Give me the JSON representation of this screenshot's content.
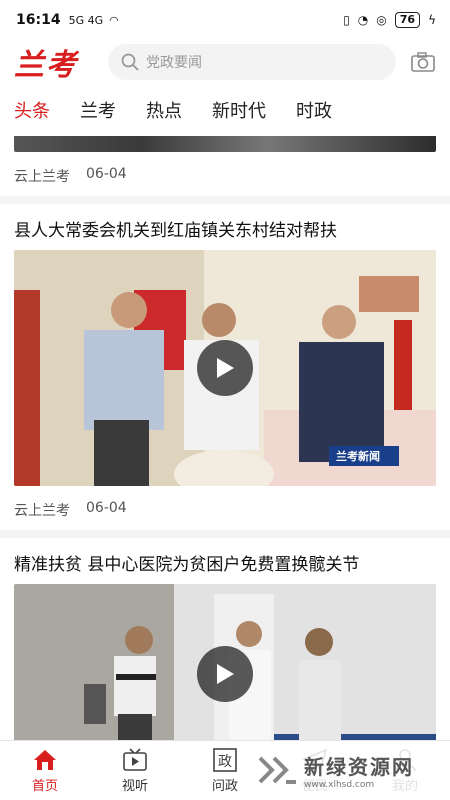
{
  "status_bar": {
    "time": "16:14",
    "signal_left": "5G 4G",
    "battery": "76"
  },
  "header": {
    "logo": "兰考",
    "search_placeholder": "党政要闻"
  },
  "tabs": [
    {
      "label": "头条",
      "active": true
    },
    {
      "label": "兰考",
      "active": false
    },
    {
      "label": "热点",
      "active": false
    },
    {
      "label": "新时代",
      "active": false
    },
    {
      "label": "时政",
      "active": false
    }
  ],
  "feed": {
    "item0": {
      "source": "云上兰考",
      "date": "06-04"
    },
    "item1": {
      "title": "县人大常委会机关到红庙镇关东村结对帮扶",
      "source": "云上兰考",
      "date": "06-04",
      "video_overlay": "兰考新闻"
    },
    "item2": {
      "title": "精准扶贫 县中心医院为贫困户免费置换髋关节"
    }
  },
  "bottom_nav": [
    {
      "label": "首页",
      "icon": "home-icon",
      "active": true
    },
    {
      "label": "视听",
      "icon": "tv-icon",
      "active": false
    },
    {
      "label": "问政",
      "icon": "politics-icon",
      "active": false
    },
    {
      "label": "便民",
      "icon": "send-icon",
      "active": false
    },
    {
      "label": "我的",
      "icon": "user-icon",
      "active": false
    }
  ],
  "watermark": {
    "text": "新绿资源网",
    "sub": "www.xlhsd.com"
  },
  "colors": {
    "accent": "#d81e1e"
  }
}
